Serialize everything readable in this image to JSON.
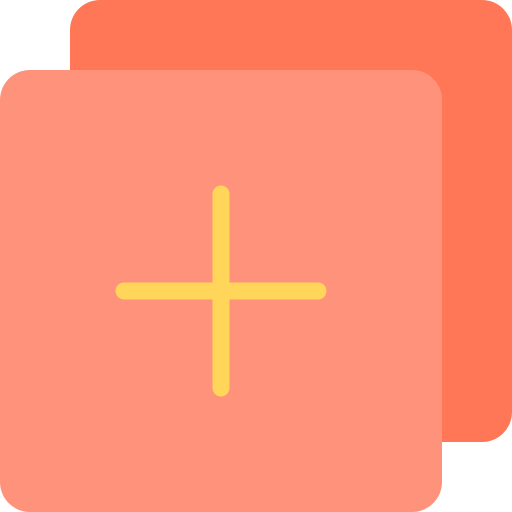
{
  "icon": {
    "name": "add-copy-icon",
    "colors": {
      "back_card": "#FF7756",
      "front_card": "#FF927A",
      "plus": "#FFD659"
    }
  }
}
